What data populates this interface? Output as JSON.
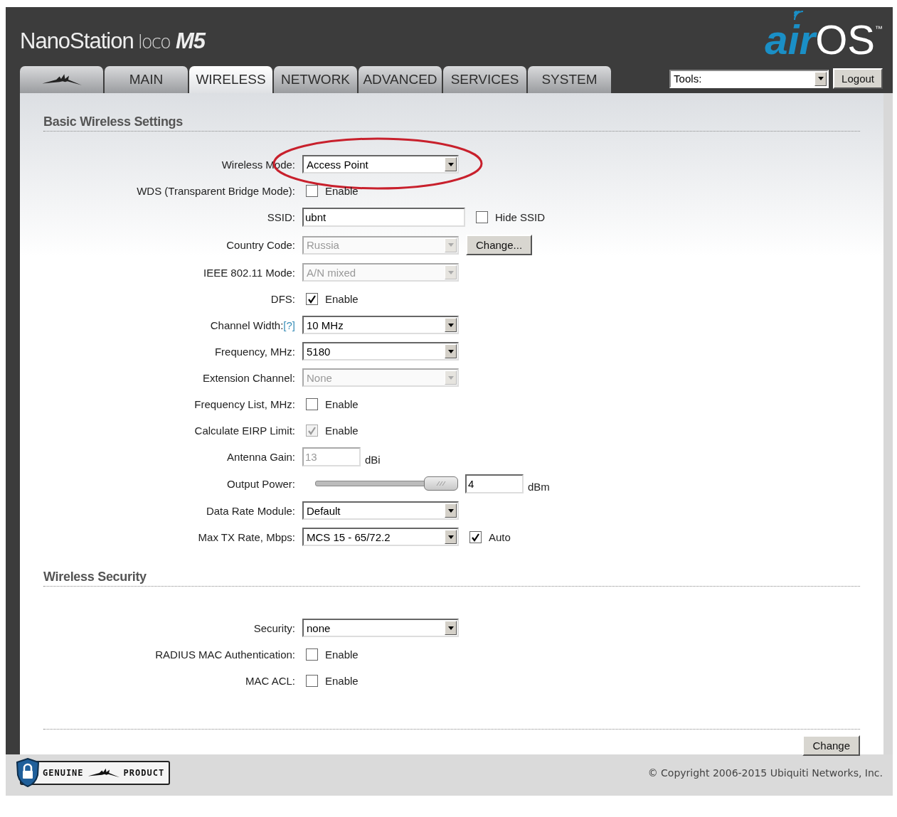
{
  "header": {
    "product": {
      "name": "NanoStation",
      "variant": "loco",
      "model": "M5"
    },
    "brand": {
      "prefix": "air",
      "name": "OS",
      "mark": "™"
    },
    "tabs": [
      {
        "kind": "logo",
        "selected": false
      },
      {
        "kind": "text",
        "label": "MAIN",
        "selected": false
      },
      {
        "kind": "text",
        "label": "WIRELESS",
        "selected": true
      },
      {
        "kind": "text",
        "label": "NETWORK",
        "selected": false
      },
      {
        "kind": "text",
        "label": "ADVANCED",
        "selected": false
      },
      {
        "kind": "text",
        "label": "SERVICES",
        "selected": false
      },
      {
        "kind": "text",
        "label": "SYSTEM",
        "selected": false
      }
    ],
    "tools": {
      "value": "Tools:"
    },
    "logout": "Logout"
  },
  "sections": [
    {
      "title": "Basic Wireless Settings",
      "rows": [
        {
          "label": "Wireless Mode:",
          "highlighted": true,
          "controls": [
            {
              "kind": "select",
              "value": "Access Point",
              "disabled": false
            }
          ]
        },
        {
          "label": "WDS (Transparent Bridge Mode):",
          "controls": [
            {
              "kind": "checkbox",
              "text": "Enable",
              "checked": false,
              "disabled": false
            }
          ]
        },
        {
          "label": "SSID:",
          "controls": [
            {
              "kind": "text",
              "value": "ubnt",
              "disabled": false
            },
            {
              "kind": "checkbox",
              "text": "Hide SSID",
              "checked": false,
              "disabled": false
            }
          ]
        },
        {
          "label": "Country Code:",
          "controls": [
            {
              "kind": "select",
              "value": "Russia",
              "disabled": true
            },
            {
              "kind": "button",
              "text": "Change..."
            }
          ]
        },
        {
          "label": "IEEE 802.11 Mode:",
          "controls": [
            {
              "kind": "select",
              "value": "A/N mixed",
              "disabled": true
            }
          ]
        },
        {
          "label": "DFS:",
          "controls": [
            {
              "kind": "checkbox",
              "text": "Enable",
              "checked": true,
              "disabled": false
            }
          ]
        },
        {
          "label": "Channel Width:",
          "help": "[?]",
          "controls": [
            {
              "kind": "select",
              "value": "10 MHz",
              "disabled": false
            }
          ]
        },
        {
          "label": "Frequency, MHz:",
          "controls": [
            {
              "kind": "select",
              "value": "5180",
              "disabled": false
            }
          ]
        },
        {
          "label": "Extension Channel:",
          "controls": [
            {
              "kind": "select",
              "value": "None",
              "disabled": true
            }
          ]
        },
        {
          "label": "Frequency List, MHz:",
          "controls": [
            {
              "kind": "checkbox",
              "text": "Enable",
              "checked": false,
              "disabled": false
            }
          ]
        },
        {
          "label": "Calculate EIRP Limit:",
          "controls": [
            {
              "kind": "checkbox",
              "text": "Enable",
              "checked": true,
              "disabled": true
            }
          ]
        },
        {
          "label": "Antenna Gain:",
          "controls": [
            {
              "kind": "number",
              "value": "13",
              "disabled": true
            },
            {
              "kind": "unit",
              "text": "dBi"
            }
          ]
        },
        {
          "label": "Output Power:",
          "controls": [
            {
              "kind": "slider",
              "level": 1
            },
            {
              "kind": "number",
              "value": "4",
              "disabled": false
            },
            {
              "kind": "unit",
              "text": "dBm"
            }
          ]
        },
        {
          "label": "Data Rate Module:",
          "controls": [
            {
              "kind": "select",
              "value": "Default",
              "disabled": false
            }
          ]
        },
        {
          "label": "Max TX Rate, Mbps:",
          "controls": [
            {
              "kind": "select",
              "value": "MCS 15 - 65/72.2",
              "disabled": false
            },
            {
              "kind": "checkbox",
              "text": "Auto",
              "checked": true,
              "disabled": false
            }
          ]
        }
      ]
    },
    {
      "title": "Wireless Security",
      "rows": [
        {
          "label": "Security:",
          "controls": [
            {
              "kind": "select",
              "value": "none",
              "disabled": false
            }
          ]
        },
        {
          "label": "RADIUS MAC Authentication:",
          "controls": [
            {
              "kind": "checkbox",
              "text": "Enable",
              "checked": false,
              "disabled": false
            }
          ]
        },
        {
          "label": "MAC ACL:",
          "controls": [
            {
              "kind": "checkbox",
              "text": "Enable",
              "checked": false,
              "disabled": false
            }
          ]
        }
      ]
    }
  ],
  "submit": "Change",
  "footer": {
    "badge": {
      "left": "GENUINE",
      "right": "PRODUCT"
    },
    "copyright": "© Copyright 2006-2015 Ubiquiti Networks, Inc."
  }
}
